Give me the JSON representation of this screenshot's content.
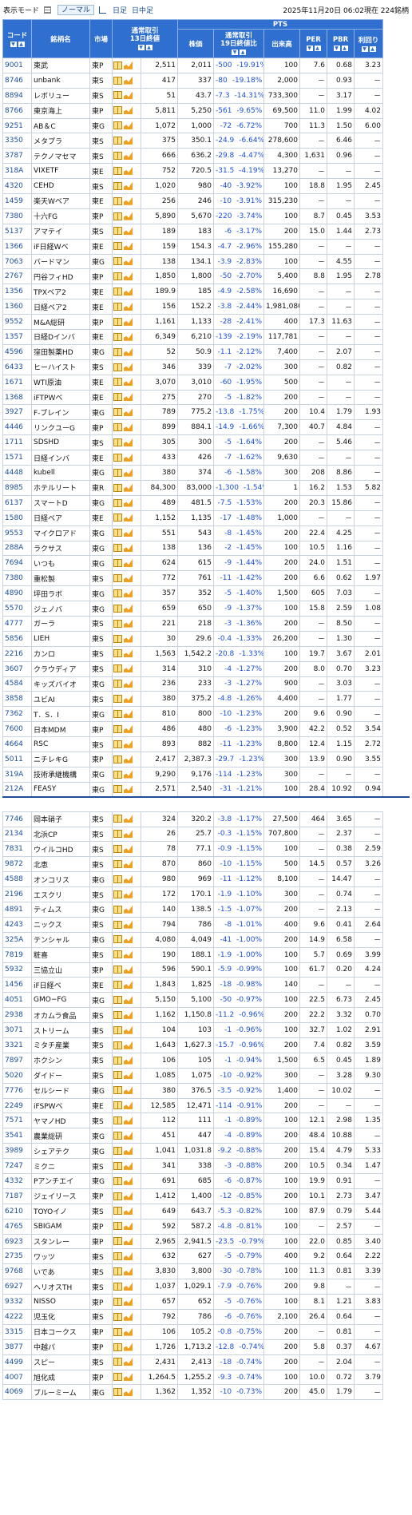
{
  "header": {
    "mode_label": "表示モード",
    "normal": "ノーマル",
    "daily": "日足",
    "intraday": "日中足",
    "timestamp": "2025年11月20日 06:02現在 224銘柄"
  },
  "columns": {
    "code": "コード",
    "name": "銘柄名",
    "market": "市場",
    "regular": "通常取引\n13日終値",
    "pts": "PTS",
    "price": "株価",
    "change": "通常取引\n19日終値比",
    "volume": "出来高",
    "per": "PER",
    "pbr": "PBR",
    "yield": "利回り"
  },
  "rows1": [
    [
      "9001",
      "東武",
      "東P",
      "2,511",
      "2,011",
      "-500",
      "-19.91%",
      "100",
      "7.6",
      "0.68",
      "3.23"
    ],
    [
      "8746",
      "unbank",
      "東S",
      "417",
      "337",
      "-80",
      "-19.18%",
      "2,000",
      "－",
      "0.93",
      "－"
    ],
    [
      "8894",
      "レボリュー",
      "東S",
      "51",
      "43.7",
      "-7.3",
      "-14.31%",
      "733,300",
      "－",
      "3.17",
      "－"
    ],
    [
      "8766",
      "東京海上",
      "東P",
      "5,811",
      "5,250",
      "-561",
      "-9.65%",
      "69,500",
      "11.0",
      "1.99",
      "4.02"
    ],
    [
      "9251",
      "AB＆C",
      "東G",
      "1,072",
      "1,000",
      "-72",
      "-6.72%",
      "700",
      "11.3",
      "1.50",
      "6.00"
    ],
    [
      "3350",
      "メタプラ",
      "東S",
      "375",
      "350.1",
      "-24.9",
      "-6.64%",
      "278,600",
      "－",
      "6.46",
      "－"
    ],
    [
      "3787",
      "テクノマセマ",
      "東S",
      "666",
      "636.2",
      "-29.8",
      "-4.47%",
      "4,300",
      "1,631",
      "0.96",
      "－"
    ],
    [
      "318A",
      "VIXETF",
      "東E",
      "752",
      "720.5",
      "-31.5",
      "-4.19%",
      "13,270",
      "－",
      "－",
      "－"
    ],
    [
      "4320",
      "CEHD",
      "東S",
      "1,020",
      "980",
      "-40",
      "-3.92%",
      "100",
      "18.8",
      "1.95",
      "2.45"
    ],
    [
      "1459",
      "楽天Wベア",
      "東E",
      "256",
      "246",
      "-10",
      "-3.91%",
      "315,230",
      "－",
      "－",
      "－"
    ],
    [
      "7380",
      "十六FG",
      "東P",
      "5,890",
      "5,670",
      "-220",
      "-3.74%",
      "100",
      "8.7",
      "0.45",
      "3.53"
    ],
    [
      "5137",
      "アマテイ",
      "東S",
      "189",
      "183",
      "-6",
      "-3.17%",
      "200",
      "15.0",
      "1.44",
      "2.73"
    ],
    [
      "1366",
      "iF日経Wベ",
      "東E",
      "159",
      "154.3",
      "-4.7",
      "-2.96%",
      "155,280",
      "－",
      "－",
      "－"
    ],
    [
      "7063",
      "バードマン",
      "東G",
      "138",
      "134.1",
      "-3.9",
      "-2.83%",
      "100",
      "－",
      "4.55",
      "－"
    ],
    [
      "2767",
      "円谷フィHD",
      "東P",
      "1,850",
      "1,800",
      "-50",
      "-2.70%",
      "5,400",
      "8.8",
      "1.95",
      "2.78"
    ],
    [
      "1356",
      "TPXベア2",
      "東E",
      "189.9",
      "185",
      "-4.9",
      "-2.58%",
      "16,690",
      "－",
      "－",
      "－"
    ],
    [
      "1360",
      "日経ベア2",
      "東E",
      "156",
      "152.2",
      "-3.8",
      "-2.44%",
      "1,981,080",
      "－",
      "－",
      "－"
    ],
    [
      "9552",
      "M&A総研",
      "東P",
      "1,161",
      "1,133",
      "-28",
      "-2.41%",
      "400",
      "17.3",
      "11.63",
      "－"
    ],
    [
      "1357",
      "日経Dインバ",
      "東E",
      "6,349",
      "6,210",
      "-139",
      "-2.19%",
      "117,781",
      "－",
      "－",
      "－"
    ],
    [
      "4596",
      "窪田製薬HD",
      "東G",
      "52",
      "50.9",
      "-1.1",
      "-2.12%",
      "7,400",
      "－",
      "2.07",
      "－"
    ],
    [
      "6433",
      "ヒーハイスト",
      "東S",
      "346",
      "339",
      "-7",
      "-2.02%",
      "300",
      "－",
      "0.82",
      "－"
    ],
    [
      "1671",
      "WTI原油",
      "東E",
      "3,070",
      "3,010",
      "-60",
      "-1.95%",
      "500",
      "－",
      "－",
      "－"
    ],
    [
      "1368",
      "iFTPWベ",
      "東E",
      "275",
      "270",
      "-5",
      "-1.82%",
      "200",
      "－",
      "－",
      "－"
    ],
    [
      "3927",
      "F-ブレイン",
      "東G",
      "789",
      "775.2",
      "-13.8",
      "-1.75%",
      "200",
      "10.4",
      "1.79",
      "1.93"
    ],
    [
      "4446",
      "リンクユーG",
      "東P",
      "899",
      "884.1",
      "-14.9",
      "-1.66%",
      "7,300",
      "40.7",
      "4.84",
      "－"
    ],
    [
      "1711",
      "SDSHD",
      "東S",
      "305",
      "300",
      "-5",
      "-1.64%",
      "200",
      "－",
      "5.46",
      "－"
    ],
    [
      "1571",
      "日経インバ",
      "東E",
      "433",
      "426",
      "-7",
      "-1.62%",
      "9,630",
      "－",
      "－",
      "－"
    ],
    [
      "4448",
      "kubell",
      "東G",
      "380",
      "374",
      "-6",
      "-1.58%",
      "300",
      "208",
      "8.86",
      "－"
    ],
    [
      "8985",
      "ホテルリート",
      "東R",
      "84,300",
      "83,000",
      "-1,300",
      "-1.54%",
      "1",
      "16.2",
      "1.53",
      "5.82"
    ],
    [
      "6137",
      "スマートD",
      "東G",
      "489",
      "481.5",
      "-7.5",
      "-1.53%",
      "200",
      "20.3",
      "15.86",
      "－"
    ],
    [
      "1580",
      "日経ベア",
      "東E",
      "1,152",
      "1,135",
      "-17",
      "-1.48%",
      "1,000",
      "－",
      "－",
      "－"
    ],
    [
      "9553",
      "マイクロアド",
      "東G",
      "551",
      "543",
      "-8",
      "-1.45%",
      "200",
      "22.4",
      "4.25",
      "－"
    ],
    [
      "288A",
      "ラクサス",
      "東G",
      "138",
      "136",
      "-2",
      "-1.45%",
      "100",
      "10.5",
      "1.16",
      "－"
    ],
    [
      "7694",
      "いつも",
      "東G",
      "624",
      "615",
      "-9",
      "-1.44%",
      "200",
      "24.0",
      "1.51",
      "－"
    ],
    [
      "7380",
      "重松製",
      "東S",
      "772",
      "761",
      "-11",
      "-1.42%",
      "200",
      "6.6",
      "0.62",
      "1.97"
    ],
    [
      "4890",
      "坪田ラボ",
      "東G",
      "357",
      "352",
      "-5",
      "-1.40%",
      "1,500",
      "605",
      "7.03",
      "－"
    ],
    [
      "5570",
      "ジェノバ",
      "東G",
      "659",
      "650",
      "-9",
      "-1.37%",
      "100",
      "15.8",
      "2.59",
      "1.08"
    ],
    [
      "4777",
      "ガーラ",
      "東S",
      "221",
      "218",
      "-3",
      "-1.36%",
      "200",
      "－",
      "8.50",
      "－"
    ],
    [
      "5856",
      "LIEH",
      "東S",
      "30",
      "29.6",
      "-0.4",
      "-1.33%",
      "26,200",
      "－",
      "1.30",
      "－"
    ],
    [
      "2216",
      "カンロ",
      "東S",
      "1,563",
      "1,542.2",
      "-20.8",
      "-1.33%",
      "100",
      "19.7",
      "3.67",
      "2.01"
    ],
    [
      "3607",
      "クラウディア",
      "東S",
      "314",
      "310",
      "-4",
      "-1.27%",
      "200",
      "8.0",
      "0.70",
      "3.23"
    ],
    [
      "4584",
      "キッズバイオ",
      "東G",
      "236",
      "233",
      "-3",
      "-1.27%",
      "900",
      "－",
      "3.03",
      "－"
    ],
    [
      "3858",
      "ユビAI",
      "東S",
      "380",
      "375.2",
      "-4.8",
      "-1.26%",
      "4,400",
      "－",
      "1.77",
      "－"
    ],
    [
      "7362",
      "T．S．I",
      "東G",
      "810",
      "800",
      "-10",
      "-1.23%",
      "200",
      "9.6",
      "0.90",
      "－"
    ],
    [
      "7600",
      "日本MDM",
      "東P",
      "486",
      "480",
      "-6",
      "-1.23%",
      "3,900",
      "42.2",
      "0.52",
      "3.54"
    ],
    [
      "4664",
      "RSC",
      "東S",
      "893",
      "882",
      "-11",
      "-1.23%",
      "8,800",
      "12.4",
      "1.15",
      "2.72"
    ],
    [
      "5011",
      "ニチレキG",
      "東P",
      "2,417",
      "2,387.3",
      "-29.7",
      "-1.23%",
      "300",
      "13.9",
      "0.90",
      "3.55"
    ],
    [
      "319A",
      "技術承継機構",
      "東G",
      "9,290",
      "9,176",
      "-114",
      "-1.23%",
      "300",
      "－",
      "－",
      "－"
    ],
    [
      "212A",
      "FEASY",
      "東G",
      "2,571",
      "2,540",
      "-31",
      "-1.21%",
      "100",
      "28.4",
      "10.92",
      "0.94"
    ]
  ],
  "rows2": [
    [
      "7746",
      "岡本硝子",
      "東S",
      "324",
      "320.2",
      "-3.8",
      "-1.17%",
      "27,500",
      "464",
      "3.65",
      "－"
    ],
    [
      "2134",
      "北浜CP",
      "東S",
      "26",
      "25.7",
      "-0.3",
      "-1.15%",
      "707,800",
      "－",
      "2.37",
      "－"
    ],
    [
      "7831",
      "ウイルコHD",
      "東S",
      "78",
      "77.1",
      "-0.9",
      "-1.15%",
      "100",
      "－",
      "0.38",
      "2.59"
    ],
    [
      "9872",
      "北恵",
      "東S",
      "870",
      "860",
      "-10",
      "-1.15%",
      "500",
      "14.5",
      "0.57",
      "3.26"
    ],
    [
      "4588",
      "オンコリス",
      "東G",
      "980",
      "969",
      "-11",
      "-1.12%",
      "8,100",
      "－",
      "14.47",
      "－"
    ],
    [
      "2196",
      "エスクリ",
      "東S",
      "172",
      "170.1",
      "-1.9",
      "-1.10%",
      "300",
      "－",
      "0.74",
      "－"
    ],
    [
      "4891",
      "ティムス",
      "東G",
      "140",
      "138.5",
      "-1.5",
      "-1.07%",
      "200",
      "－",
      "2.13",
      "－"
    ],
    [
      "4243",
      "ニックス",
      "東S",
      "794",
      "786",
      "-8",
      "-1.01%",
      "400",
      "9.6",
      "0.41",
      "2.64"
    ],
    [
      "325A",
      "テンシャル",
      "東G",
      "4,080",
      "4,049",
      "-41",
      "-1.00%",
      "200",
      "14.9",
      "6.58",
      "－"
    ],
    [
      "7819",
      "粧喜",
      "東S",
      "190",
      "188.1",
      "-1.9",
      "-1.00%",
      "100",
      "5.7",
      "0.69",
      "3.99"
    ],
    [
      "5932",
      "三協立山",
      "東P",
      "596",
      "590.1",
      "-5.9",
      "-0.99%",
      "100",
      "61.7",
      "0.20",
      "4.24"
    ],
    [
      "1456",
      "iF日経ベ",
      "東E",
      "1,843",
      "1,825",
      "-18",
      "-0.98%",
      "140",
      "－",
      "－",
      "－"
    ],
    [
      "4051",
      "GMO−FG",
      "東G",
      "5,150",
      "5,100",
      "-50",
      "-0.97%",
      "100",
      "22.5",
      "6.73",
      "2.45"
    ],
    [
      "2938",
      "オカムラ食品",
      "東S",
      "1,162",
      "1,150.8",
      "-11.2",
      "-0.96%",
      "200",
      "22.2",
      "3.32",
      "0.70"
    ],
    [
      "3071",
      "ストリーム",
      "東S",
      "104",
      "103",
      "-1",
      "-0.96%",
      "100",
      "32.7",
      "1.02",
      "2.91"
    ],
    [
      "3321",
      "ミタチ産業",
      "東S",
      "1,643",
      "1,627.3",
      "-15.7",
      "-0.96%",
      "200",
      "7.4",
      "0.82",
      "3.59"
    ],
    [
      "7897",
      "ホクシン",
      "東S",
      "106",
      "105",
      "-1",
      "-0.94%",
      "1,500",
      "6.5",
      "0.45",
      "1.89"
    ],
    [
      "5020",
      "ダイドー",
      "東S",
      "1,085",
      "1,075",
      "-10",
      "-0.92%",
      "300",
      "－",
      "3.28",
      "9.30"
    ],
    [
      "7776",
      "セルシード",
      "東G",
      "380",
      "376.5",
      "-3.5",
      "-0.92%",
      "1,400",
      "－",
      "10.02",
      "－"
    ],
    [
      "2249",
      "iFSPWベ",
      "東E",
      "12,585",
      "12,471",
      "-114",
      "-0.91%",
      "200",
      "－",
      "－",
      "－"
    ],
    [
      "7571",
      "ヤマノHD",
      "東S",
      "112",
      "111",
      "-1",
      "-0.89%",
      "100",
      "12.1",
      "2.98",
      "1.35"
    ],
    [
      "3541",
      "農業総研",
      "東G",
      "451",
      "447",
      "-4",
      "-0.89%",
      "200",
      "48.4",
      "10.88",
      "－"
    ],
    [
      "3989",
      "シェアテク",
      "東G",
      "1,041",
      "1,031.8",
      "-9.2",
      "-0.88%",
      "200",
      "15.4",
      "4.79",
      "5.33"
    ],
    [
      "7247",
      "ミクニ",
      "東S",
      "341",
      "338",
      "-3",
      "-0.88%",
      "200",
      "10.5",
      "0.34",
      "1.47"
    ],
    [
      "4332",
      "Pアンチエイ",
      "東G",
      "691",
      "685",
      "-6",
      "-0.87%",
      "100",
      "19.9",
      "0.91",
      "－"
    ],
    [
      "7187",
      "ジェイリース",
      "東P",
      "1,412",
      "1,400",
      "-12",
      "-0.85%",
      "200",
      "10.1",
      "2.73",
      "3.47"
    ],
    [
      "6210",
      "TOYOイノ",
      "東S",
      "649",
      "643.7",
      "-5.3",
      "-0.82%",
      "100",
      "87.9",
      "0.79",
      "5.44"
    ],
    [
      "4765",
      "SBIGAM",
      "東P",
      "592",
      "587.2",
      "-4.8",
      "-0.81%",
      "100",
      "－",
      "2.57",
      "－"
    ],
    [
      "6923",
      "スタンレー",
      "東P",
      "2,965",
      "2,941.5",
      "-23.5",
      "-0.79%",
      "100",
      "22.0",
      "0.85",
      "3.40"
    ],
    [
      "2735",
      "ワッツ",
      "東S",
      "632",
      "627",
      "-5",
      "-0.79%",
      "400",
      "9.2",
      "0.64",
      "2.22"
    ],
    [
      "9768",
      "いであ",
      "東S",
      "3,830",
      "3,800",
      "-30",
      "-0.78%",
      "100",
      "11.3",
      "0.81",
      "3.39"
    ],
    [
      "6927",
      "ヘリオスTH",
      "東S",
      "1,037",
      "1,029.1",
      "-7.9",
      "-0.76%",
      "200",
      "9.8",
      "－",
      "－"
    ],
    [
      "9332",
      "NISSO",
      "東P",
      "657",
      "652",
      "-5",
      "-0.76%",
      "100",
      "8.1",
      "1.21",
      "3.83"
    ],
    [
      "4222",
      "児玉化",
      "東S",
      "792",
      "786",
      "-6",
      "-0.76%",
      "2,100",
      "26.4",
      "0.64",
      "－"
    ],
    [
      "3315",
      "日本コークス",
      "東P",
      "106",
      "105.2",
      "-0.8",
      "-0.75%",
      "200",
      "－",
      "0.81",
      "－"
    ],
    [
      "3877",
      "中越パ",
      "東P",
      "1,726",
      "1,713.2",
      "-12.8",
      "-0.74%",
      "200",
      "5.8",
      "0.37",
      "4.67"
    ],
    [
      "4499",
      "スピー",
      "東S",
      "2,431",
      "2,413",
      "-18",
      "-0.74%",
      "200",
      "－",
      "2.04",
      "－"
    ],
    [
      "4007",
      "旭化成",
      "東P",
      "1,264.5",
      "1,255.2",
      "-9.3",
      "-0.74%",
      "100",
      "10.0",
      "0.72",
      "3.79"
    ],
    [
      "4069",
      "ブルーミーム",
      "東G",
      "1,362",
      "1,352",
      "-10",
      "-0.73%",
      "200",
      "45.0",
      "1.79",
      "－"
    ]
  ]
}
